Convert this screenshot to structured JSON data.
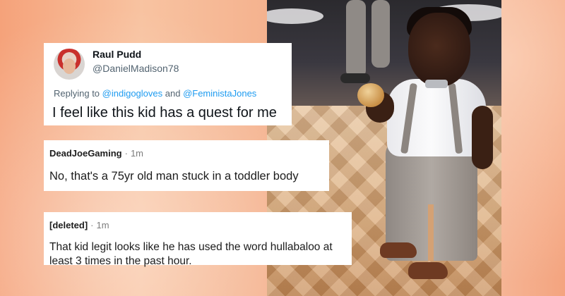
{
  "tweet": {
    "display_name": "Raul Pudd",
    "handle": "@DanielMadison78",
    "replying_prefix": "Replying to ",
    "mention_1": "@indigogloves",
    "replying_and": " and ",
    "mention_2": "@FeministaJones",
    "text": "I feel like this kid has a quest for me"
  },
  "comments": [
    {
      "user": "DeadJoeGaming",
      "separator": "·",
      "time": "1m",
      "text": "No, that's a 75yr old man stuck in a toddler body"
    },
    {
      "user": "[deleted]",
      "separator": "·",
      "time": "1m",
      "text": "That kid legit looks like he has used the word hullabaloo at least 3 times in the past hour."
    }
  ],
  "colors": {
    "background_accent": "#f5a27a",
    "mention_blue": "#1d9bf0",
    "muted_gray": "#536471"
  }
}
